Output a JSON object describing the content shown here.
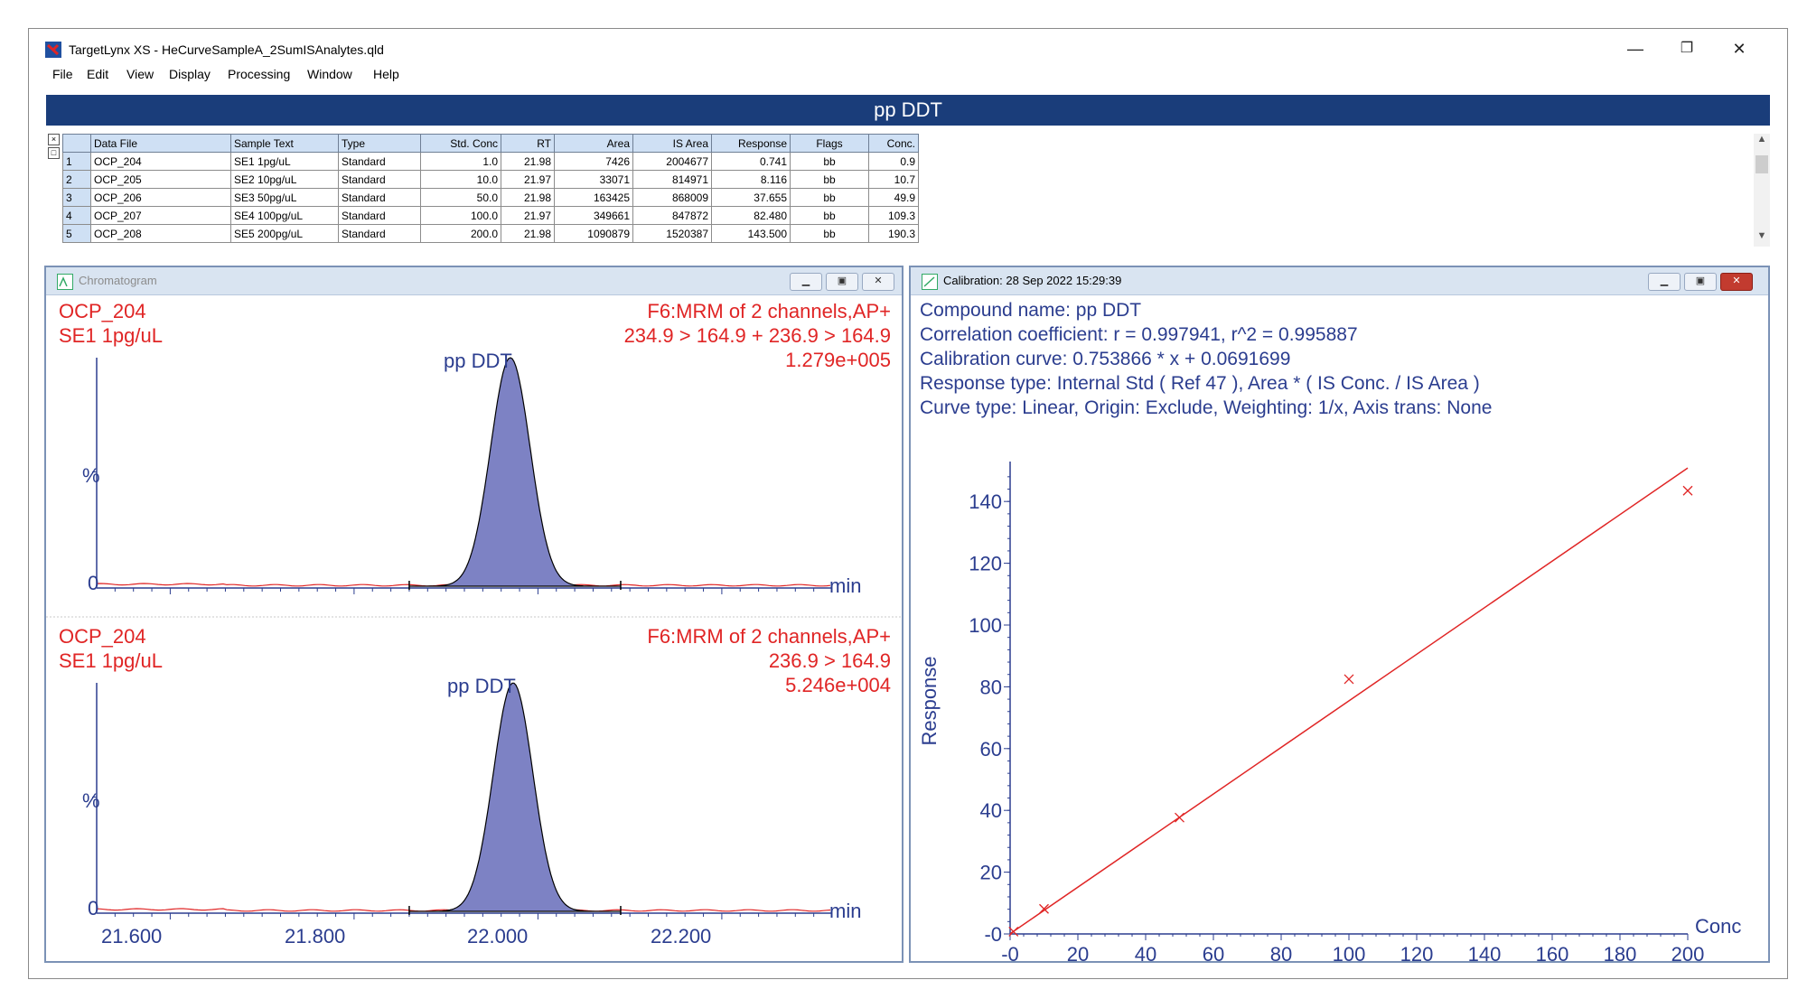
{
  "window": {
    "title": "TargetLynx XS - HeCurveSampleA_2SumISAnalytes.qld",
    "min": "—",
    "max": "❐",
    "close": "✕"
  },
  "menu": [
    "File",
    "Edit",
    "View",
    "Display",
    "Processing",
    "Window",
    "Help"
  ],
  "compound_header": "pp DDT",
  "table": {
    "columns": [
      "Data File",
      "Sample Text",
      "Type",
      "Std. Conc",
      "RT",
      "Area",
      "IS Area",
      "Response",
      "Flags",
      "Conc."
    ],
    "rows": [
      [
        "1",
        "OCP_204",
        "SE1 1pg/uL",
        "Standard",
        "1.0",
        "21.98",
        "7426",
        "2004677",
        "0.741",
        "bb",
        "0.9"
      ],
      [
        "2",
        "OCP_205",
        "SE2 10pg/uL",
        "Standard",
        "10.0",
        "21.97",
        "33071",
        "814971",
        "8.116",
        "bb",
        "10.7"
      ],
      [
        "3",
        "OCP_206",
        "SE3 50pg/uL",
        "Standard",
        "50.0",
        "21.98",
        "163425",
        "868009",
        "37.655",
        "bb",
        "49.9"
      ],
      [
        "4",
        "OCP_207",
        "SE4 100pg/uL",
        "Standard",
        "100.0",
        "21.97",
        "349661",
        "847872",
        "82.480",
        "bb",
        "109.3"
      ],
      [
        "5",
        "OCP_208",
        "SE5 200pg/uL",
        "Standard",
        "200.0",
        "21.98",
        "1090879",
        "1520387",
        "143.500",
        "bb",
        "190.3"
      ]
    ],
    "side_buttons": [
      "×",
      "□"
    ],
    "scroll_up": "▲",
    "scroll_down": "▼"
  },
  "chromatogram": {
    "title": "Chromatogram",
    "traces": [
      {
        "sample": "OCP_204",
        "sample_text": "SE1 1pg/uL",
        "function": "F6:MRM of 2 channels,AP+",
        "transition": "234.9 > 164.9 + 236.9 > 164.9",
        "intensity": "1.279e+005",
        "peak_label": "pp DDT",
        "y_axis_label": "%",
        "y_zero": "0",
        "x_unit": "min"
      },
      {
        "sample": "OCP_204",
        "sample_text": "SE1 1pg/uL",
        "function": "F6:MRM of 2 channels,AP+",
        "transition": "236.9 > 164.9",
        "intensity": "5.246e+004",
        "peak_label": "pp DDT",
        "y_axis_label": "%",
        "y_zero": "0",
        "x_unit": "min"
      }
    ],
    "x_ticks": [
      "21.600",
      "21.800",
      "22.000",
      "22.200"
    ],
    "peak_fill": "#7d82c4"
  },
  "calibration": {
    "title": "Calibration: 28 Sep 2022 15:29:39",
    "compound_name": "Compound name: pp DDT",
    "correlation": "Correlation coefficient: r = 0.997941, r^2 = 0.995887",
    "curve": "Calibration curve: 0.753866 * x + 0.0691699",
    "response_type": "Response type: Internal Std ( Ref 47 ), Area * ( IS Conc. / IS Area )",
    "curve_type": "Curve type: Linear, Origin: Exclude, Weighting: 1/x, Axis trans: None"
  },
  "chart_data": {
    "type": "scatter",
    "xlabel": "Conc",
    "ylabel": "Response",
    "xlim": [
      0,
      200
    ],
    "ylim": [
      0,
      150
    ],
    "x_ticks": [
      "-0",
      "20",
      "40",
      "60",
      "80",
      "100",
      "120",
      "140",
      "160",
      "180",
      "200"
    ],
    "y_ticks": [
      "-0",
      "20",
      "40",
      "60",
      "80",
      "100",
      "120",
      "140"
    ],
    "points": [
      {
        "x": 1.0,
        "y": 0.741
      },
      {
        "x": 10.0,
        "y": 8.116
      },
      {
        "x": 50.0,
        "y": 37.655
      },
      {
        "x": 100.0,
        "y": 82.48
      },
      {
        "x": 200.0,
        "y": 143.5
      }
    ],
    "fit": {
      "slope": 0.753866,
      "intercept": 0.0691699
    },
    "color": "#e02525",
    "axis_color": "#2b3d8f"
  },
  "colors": {
    "header_bg": "#1a3d7a",
    "table_header_bg": "#cfe0f4",
    "trace_red": "#e02525",
    "label_blue": "#2b3d8f"
  }
}
